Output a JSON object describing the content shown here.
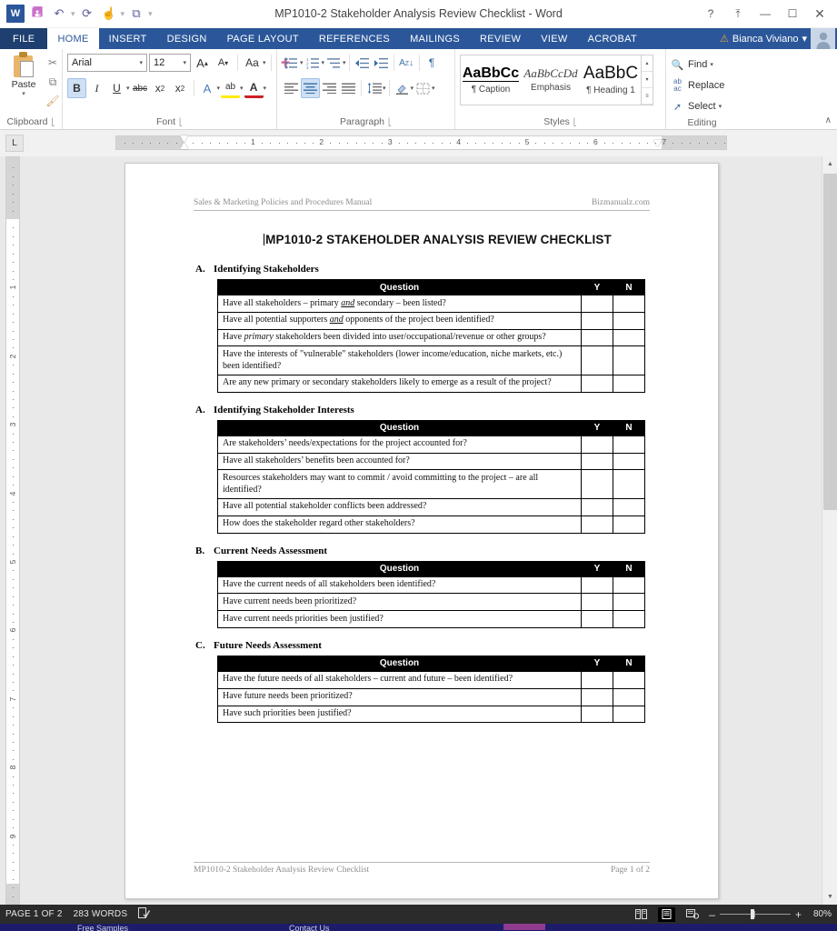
{
  "window": {
    "title": "MP1010-2 Stakeholder Analysis Review Checklist - Word",
    "app_logo": "word-logo",
    "quick_access": [
      {
        "name": "save-icon",
        "glyph": "▣"
      },
      {
        "name": "undo-icon",
        "glyph": "↶"
      },
      {
        "name": "redo-icon",
        "glyph": "↻"
      },
      {
        "name": "touch-mode-icon",
        "glyph": "☝"
      },
      {
        "name": "open-recent-icon",
        "glyph": "⧉"
      },
      {
        "name": "customize-qat-icon",
        "glyph": "≡"
      }
    ],
    "controls": {
      "help": "?",
      "ribbon_display": "⤒",
      "minimize": "—",
      "maximize": "☐",
      "close": "✕"
    }
  },
  "tabs": {
    "file": "FILE",
    "items": [
      "HOME",
      "INSERT",
      "DESIGN",
      "PAGE LAYOUT",
      "REFERENCES",
      "MAILINGS",
      "REVIEW",
      "VIEW",
      "ACROBAT"
    ],
    "active": "HOME"
  },
  "account": {
    "user_name": "Bianca Viviano",
    "warning_icon": "⚠",
    "caret": "▾"
  },
  "ribbon": {
    "groups": [
      {
        "label": "Clipboard"
      },
      {
        "label": "Font"
      },
      {
        "label": "Paragraph"
      },
      {
        "label": "Styles"
      },
      {
        "label": "Editing"
      }
    ],
    "clipboard": {
      "paste_label": "Paste",
      "paste_caret": "▾",
      "cut_icon": "✂",
      "copy_icon": "⧉",
      "format_painter_icon": "὘C"
    },
    "font": {
      "font_name": "Arial",
      "font_size": "12",
      "grow_font": "A",
      "shrink_font": "A",
      "change_case": "Aa",
      "clear_formatting": "✐",
      "bold": "B",
      "italic": "I",
      "underline": "U",
      "strikethrough": "abc",
      "subscript": "x",
      "superscript": "x",
      "text_effects": "A",
      "highlight": "ab",
      "font_color": "A",
      "bold_active": true
    },
    "paragraph": {
      "bullets": "≡",
      "numbering": "≡",
      "multilevel": "≡",
      "decrease_indent": "⇤",
      "increase_indent": "⇥",
      "sort": "A↓",
      "show_marks": "¶",
      "align_left": "align-left",
      "align_center": "align-center",
      "align_right": "align-right",
      "justify": "justify",
      "line_spacing": "↕",
      "shading": "◱",
      "borders": "⊞",
      "center_active": true
    },
    "styles": {
      "items": [
        {
          "preview": "AaBbCc",
          "name": "Caption",
          "mark": "¶"
        },
        {
          "preview": "AaBbCcDd",
          "name": "Emphasis",
          "mark": ""
        },
        {
          "preview": "AaBbC",
          "name": "Heading 1",
          "mark": "¶"
        }
      ],
      "scroll_up": "▴",
      "scroll_down": "▾",
      "more": "≡"
    },
    "editing": {
      "find": "Find",
      "find_caret": "▾",
      "replace": "Replace",
      "select": "Select",
      "select_caret": "▾",
      "find_icon": "🔍",
      "replace_icon": "ab",
      "select_icon": "↖"
    },
    "collapse_icon": "∧",
    "launcher_icon": "⬌"
  },
  "ruler": {
    "tab_selector": "L",
    "h_numbers": [
      "1",
      "1",
      "2",
      "3",
      "4",
      "5",
      "6",
      "7"
    ],
    "v_numbers": [
      "1",
      "1",
      "2",
      "3",
      "4",
      "5",
      "6",
      "7",
      "8"
    ]
  },
  "document": {
    "header_left": "Sales & Marketing Policies and Procedures Manual",
    "header_right": "Bizmanualz.com",
    "title": "MP1010-2 STAKEHOLDER ANALYSIS REVIEW CHECKLIST",
    "footer_left": "MP1010-2 Stakeholder Analysis Review Checklist",
    "footer_right": "Page 1 of 2",
    "column_headers": {
      "question": "Question",
      "yes": "Y",
      "no": "N"
    },
    "sections": [
      {
        "letter": "A.",
        "heading": "Identifying Stakeholders",
        "rows": [
          "Have all stakeholders – primary <i>and</i> secondary – been listed?",
          "Have all potential supporters <i>and</i> opponents of the project been identified?",
          "Have <em>primary</em> stakeholders been divided into user/occupational/revenue or other groups?",
          "Have the interests of \"vulnerable\" stakeholders (lower income/education, niche markets, etc.) been identified?",
          "Are any new primary or secondary stakeholders likely to emerge as a result of the project?"
        ]
      },
      {
        "letter": "A.",
        "heading": "Identifying Stakeholder Interests",
        "rows": [
          "Are stakeholders’ needs/expectations for the project accounted for?",
          "Have all stakeholders’ benefits been accounted for?",
          "Resources stakeholders may want to commit / avoid committing to the project – are all identified?",
          "Have all potential stakeholder conflicts been addressed?",
          "How does the stakeholder regard other stakeholders?"
        ]
      },
      {
        "letter": "B.",
        "heading": "Current Needs Assessment",
        "rows": [
          "Have the current needs of all stakeholders been identified?",
          "Have current needs been prioritized?",
          "Have current needs priorities been justified?"
        ]
      },
      {
        "letter": "C.",
        "heading": "Future Needs Assessment",
        "rows": [
          "Have the future needs of all stakeholders – current and future – been identified?",
          "Have future needs been prioritized?",
          "Have such priorities been justified?"
        ]
      }
    ]
  },
  "statusbar": {
    "page_indicator": "PAGE 1 OF 2",
    "word_count": "283 WORDS",
    "proofing_icon": "☑",
    "views": [
      {
        "name": "read-mode",
        "glyph": "▤",
        "active": false
      },
      {
        "name": "print-layout",
        "glyph": "▥",
        "active": true
      },
      {
        "name": "web-layout",
        "glyph": "▦",
        "active": false
      }
    ],
    "zoom_minus": "–",
    "zoom_plus": "+",
    "zoom_level": "80%"
  },
  "bottom_strip": {
    "links": [
      "Free Samples",
      "Contact Us"
    ]
  },
  "colors": {
    "ribbon_blue": "#2b579a",
    "file_tab": "#1e3f6f",
    "statusbar": "#2b2b2b",
    "workspace": "#e9e9e9",
    "accent_highlight": "#cfe0f5",
    "bottom_strip": "#1c1c6b"
  }
}
